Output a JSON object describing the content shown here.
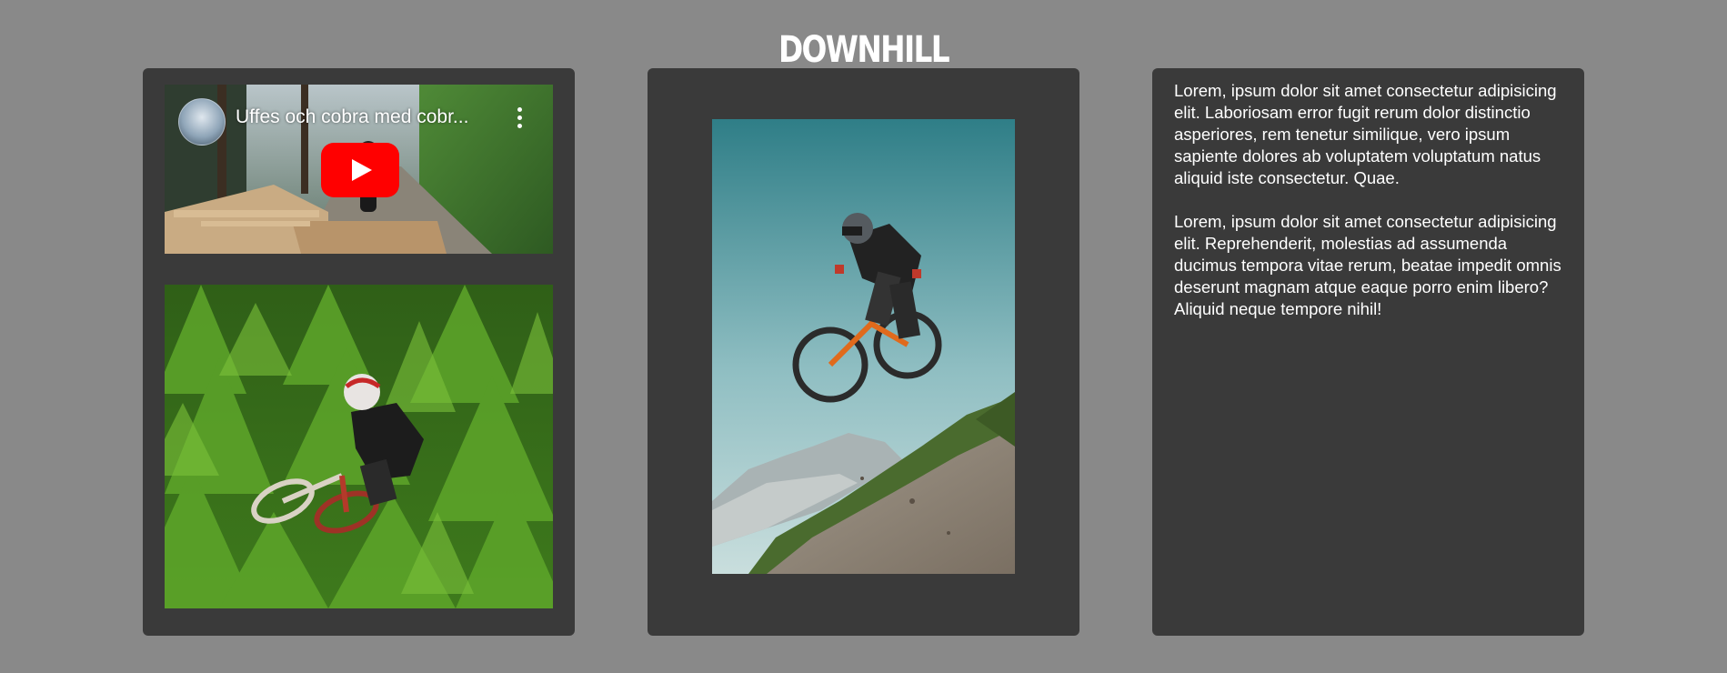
{
  "page": {
    "title": "DOWNHILL",
    "background_color": "#898989",
    "card_color": "#3a3a3a"
  },
  "video": {
    "title": "Uffes och cobra med cobr...",
    "play_button_color": "#ff0000",
    "icons": [
      "channel-avatar-icon",
      "more-vert-icon",
      "youtube-play-icon"
    ]
  },
  "images": {
    "forest_rider": "forest-downhill-rider-photo",
    "mountain_rider": "mountain-jump-rider-photo"
  },
  "text": {
    "paragraphs": [
      "Lorem, ipsum dolor sit amet consectetur adipisicing elit. Laboriosam error fugit rerum dolor distinctio asperiores, rem tenetur similique, vero ipsum sapiente dolores ab voluptatem voluptatum natus aliquid iste consectetur. Quae.",
      "Lorem, ipsum dolor sit amet consectetur adipisicing elit. Reprehenderit, molestias ad assumenda ducimus tempora vitae rerum, beatae impedit omnis deserunt magnam atque eaque porro enim libero? Aliquid neque tempore nihil!"
    ]
  }
}
